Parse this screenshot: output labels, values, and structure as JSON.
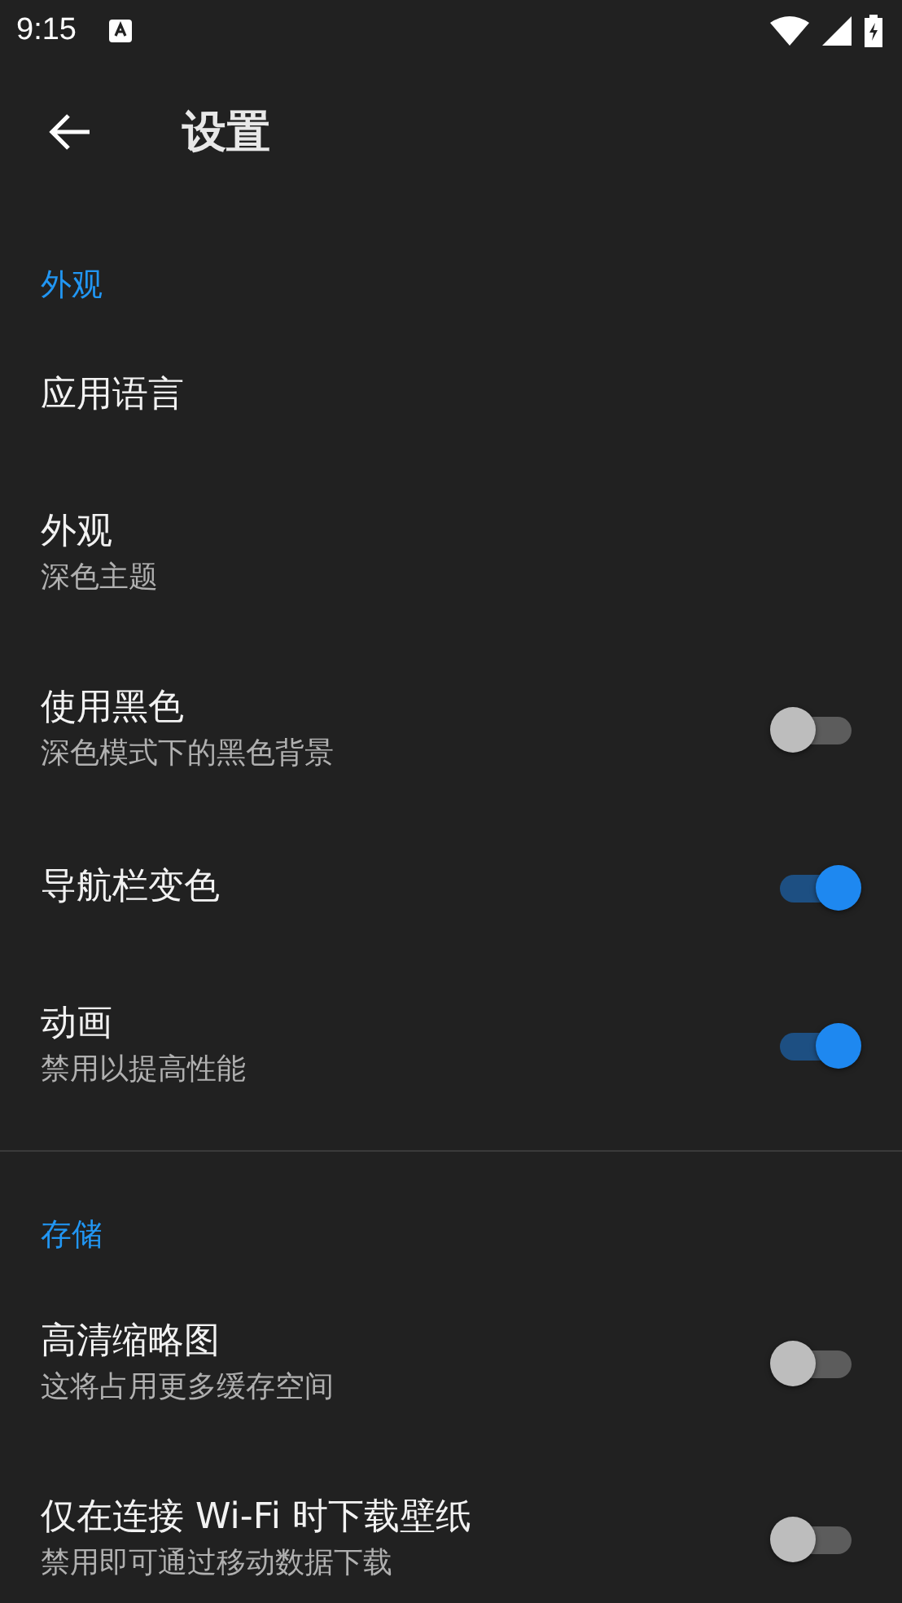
{
  "status_bar": {
    "time": "9:15"
  },
  "toolbar": {
    "title": "设置"
  },
  "sections": [
    {
      "header": "外观",
      "items": [
        {
          "kind": "plain",
          "title": "应用语言"
        },
        {
          "kind": "plain",
          "title": "外观",
          "subtitle": "深色主题"
        },
        {
          "kind": "switch",
          "title": "使用黑色",
          "subtitle": "深色模式下的黑色背景",
          "on": false
        },
        {
          "kind": "switch",
          "title": "导航栏变色",
          "on": true
        },
        {
          "kind": "switch",
          "title": "动画",
          "subtitle": "禁用以提高性能",
          "on": true
        }
      ]
    },
    {
      "header": "存储",
      "items": [
        {
          "kind": "switch",
          "title": "高清缩略图",
          "subtitle": "这将占用更多缓存空间",
          "on": false
        },
        {
          "kind": "switch",
          "title": "仅在连接 Wi-Fi 时下载壁纸",
          "subtitle": "禁用即可通过移动数据下载",
          "on": false
        }
      ]
    }
  ]
}
